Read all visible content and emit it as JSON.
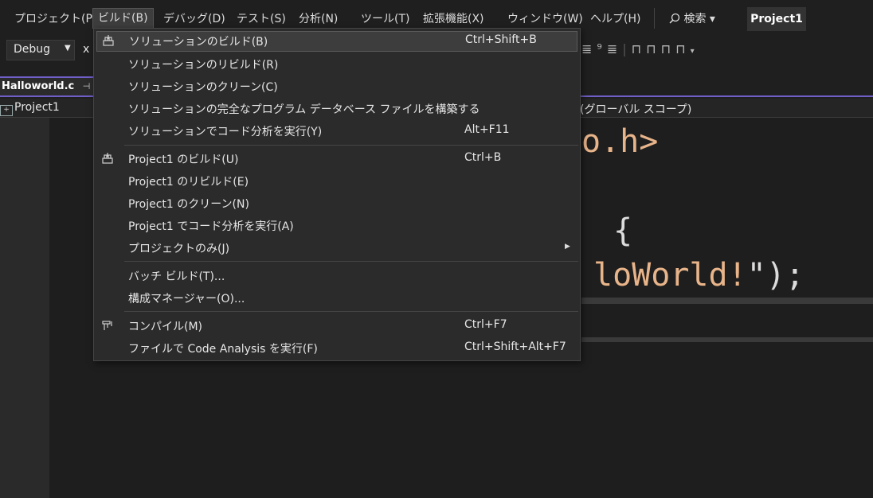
{
  "menubar": {
    "items": [
      "プロジェクト(P)",
      "ビルド(B)",
      "デバッグ(D)",
      "テスト(S)",
      "分析(N)",
      "ツール(T)",
      "拡張機能(X)",
      "ウィンドウ(W)",
      "ヘルプ(H)"
    ],
    "search_label": "検索 ▾",
    "project_badge": "Project1"
  },
  "toolbar": {
    "config": "Debug",
    "platform_partial": "x"
  },
  "tab": {
    "filename": "Halloworld.c",
    "pin_glyph": "⊣"
  },
  "navbar": {
    "project": "Project1",
    "scope": "(グローバル スコープ)"
  },
  "editor": {
    "line1": "o.h>",
    "line2": "{",
    "line3_text": "loWorld!",
    "line3_punc": "\");"
  },
  "build_menu": {
    "items": [
      {
        "label": "ソリューションのビルド(B)",
        "shortcut": "Ctrl+Shift+B",
        "icon": "build-icon"
      },
      {
        "label": "ソリューションのリビルド(R)",
        "shortcut": ""
      },
      {
        "label": "ソリューションのクリーン(C)",
        "shortcut": ""
      },
      {
        "label": "ソリューションの完全なプログラム データベース ファイルを構築する",
        "shortcut": ""
      },
      {
        "label": "ソリューションでコード分析を実行(Y)",
        "shortcut": "Alt+F11"
      },
      {
        "label": "Project1 のビルド(U)",
        "shortcut": "Ctrl+B",
        "icon": "build-icon"
      },
      {
        "label": "Project1 のリビルド(E)",
        "shortcut": ""
      },
      {
        "label": "Project1 のクリーン(N)",
        "shortcut": ""
      },
      {
        "label": "Project1 でコード分析を実行(A)",
        "shortcut": ""
      },
      {
        "label": "プロジェクトのみ(J)",
        "shortcut": "",
        "submenu": true
      },
      {
        "label": "バッチ ビルド(T)...",
        "shortcut": ""
      },
      {
        "label": "構成マネージャー(O)...",
        "shortcut": ""
      },
      {
        "label": "コンパイル(M)",
        "shortcut": "Ctrl+F7",
        "icon": "compile-icon"
      },
      {
        "label": "ファイルで Code Analysis を実行(F)",
        "shortcut": "Ctrl+Shift+Alt+F7"
      }
    ]
  }
}
